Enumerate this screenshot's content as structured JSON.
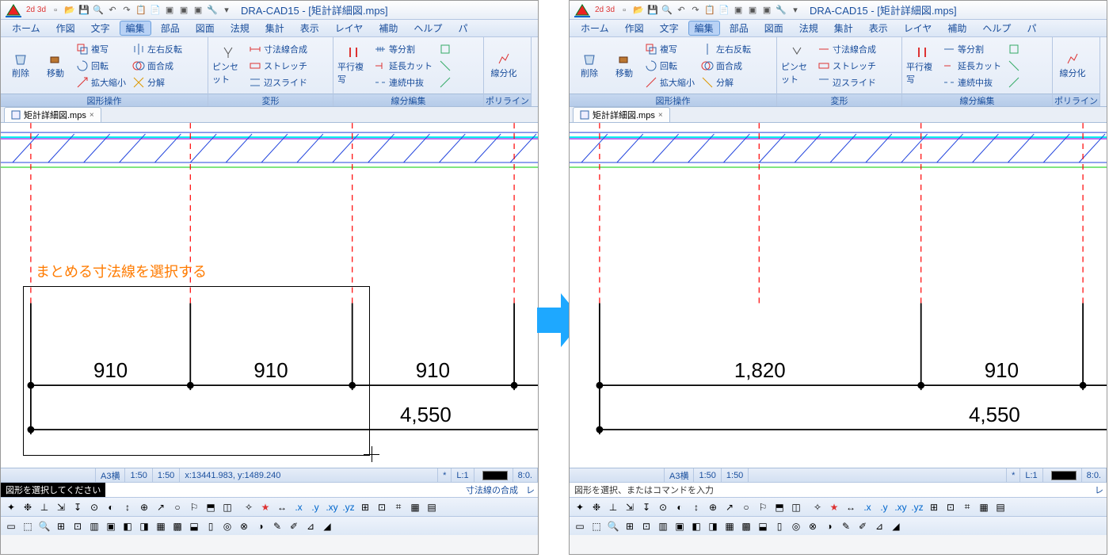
{
  "app": {
    "title": "DRA-CAD15 - [矩計詳細図.mps]",
    "mode_badge": "2d 3d"
  },
  "menus": [
    "ホーム",
    "作図",
    "文字",
    "編集",
    "部品",
    "図面",
    "法規",
    "集計",
    "表示",
    "レイヤ",
    "補助",
    "ヘルプ",
    "パ"
  ],
  "active_menu": "編集",
  "ribbon": {
    "grp1": {
      "label": "図形操作",
      "btn_delete": "削除",
      "btn_move": "移動",
      "c1": [
        "複写",
        "回転",
        "拡大縮小"
      ],
      "c2": [
        "左右反転",
        "面合成",
        "分解"
      ]
    },
    "grp2": {
      "label": "変形",
      "btn_pincet": "ピンセット",
      "c1": [
        "寸法線合成",
        "ストレッチ",
        "辺スライド"
      ]
    },
    "grp3": {
      "label": "線分編集",
      "btn_parallel": "平行複写",
      "c1": [
        "等分割",
        "延長カット",
        "連続中抜"
      ]
    },
    "grp4": {
      "label": "ポリライン",
      "btn_linify": "線分化"
    }
  },
  "tab": {
    "name": "矩計詳細図.mps"
  },
  "status": {
    "paper": "A3横",
    "scale1": "1:50",
    "scale2": "1:50",
    "coords": "x:13441.983, y:1489.240",
    "layer_l": "*",
    "layer": "L:1",
    "other": "8:0.",
    "prompt_left": "図形を選択してください",
    "mode_left": "寸法線の合成",
    "re": "レ",
    "prompt_right": "図形を選択、またはコマンドを入力"
  },
  "annotation": "まとめる寸法線を選択する",
  "dims_left": {
    "a": "910",
    "b": "910",
    "c": "910",
    "total": "4,550"
  },
  "dims_right": {
    "a": "1,820",
    "b": "910",
    "total": "4,550"
  }
}
